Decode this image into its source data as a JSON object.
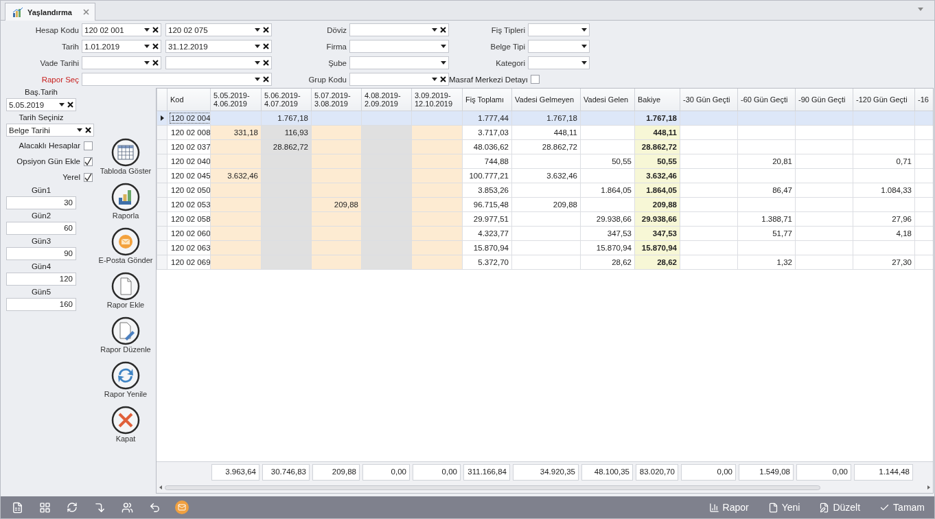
{
  "tab": {
    "title": "Yaşlandırma"
  },
  "filters": [
    {
      "label": "Hesap Kodu",
      "required": false,
      "fields": [
        {
          "value": "120 02 001",
          "clear": true
        },
        {
          "value": "120 02 075",
          "clear": true
        }
      ]
    },
    {
      "label": "Döviz",
      "required": false,
      "fields": [
        {
          "clear": true
        }
      ]
    },
    {
      "label": "Fiş Tipleri",
      "required": false,
      "fields": [
        {
          "clear": false
        }
      ]
    },
    {
      "label": "Tarih",
      "required": false,
      "fields": [
        {
          "value": "1.01.2019",
          "clear": true
        },
        {
          "value": "31.12.2019",
          "clear": true
        }
      ]
    },
    {
      "label": "Firma",
      "required": false,
      "fields": [
        {
          "clear": false
        }
      ]
    },
    {
      "label": "Belge Tipi",
      "required": false,
      "fields": [
        {
          "clear": false
        }
      ]
    },
    {
      "label": "Vade Tarihi",
      "required": false,
      "fields": [
        {
          "clear": true
        },
        {
          "clear": true
        }
      ]
    },
    {
      "label": "Şube",
      "required": false,
      "fields": [
        {
          "clear": false
        }
      ]
    },
    {
      "label": "Kategori",
      "required": false,
      "fields": [
        {
          "clear": false
        }
      ]
    },
    {
      "label": "Rapor Seç",
      "required": true,
      "fields": [
        {
          "clear": true
        }
      ]
    },
    {
      "label": "Grup Kodu",
      "required": false,
      "fields": [
        {
          "clear": true
        }
      ]
    }
  ],
  "cost_center": {
    "label": "Masraf Merkezi Detayı",
    "checked": false
  },
  "options": {
    "start_label": "Baş.Tarih",
    "start_value": "5.05.2019",
    "date_label": "Tarih Seçiniz",
    "date_value": "Belge Tarihi",
    "checks": [
      {
        "label": "Alacaklı Hesaplar",
        "checked": false
      },
      {
        "label": "Opsiyon Gün Ekle",
        "checked": true
      },
      {
        "label": "Yerel",
        "checked": true
      }
    ],
    "days": [
      {
        "label": "Gün1",
        "value": "30"
      },
      {
        "label": "Gün2",
        "value": "60"
      },
      {
        "label": "Gün3",
        "value": "90"
      },
      {
        "label": "Gün4",
        "value": "120"
      },
      {
        "label": "Gün5",
        "value": "160"
      }
    ]
  },
  "actions": [
    {
      "kind": "table",
      "label": "Tabloda Göster"
    },
    {
      "kind": "chart",
      "label": "Raporla"
    },
    {
      "kind": "mail",
      "label": "E-Posta Gönder"
    },
    {
      "kind": "new",
      "label": "Rapor Ekle"
    },
    {
      "kind": "edit",
      "label": "Rapor Düzenle"
    },
    {
      "kind": "refresh",
      "label": "Rapor Yenile"
    },
    {
      "kind": "close",
      "label": "Kapat"
    }
  ],
  "table": {
    "columns": [
      {
        "label": "Kod",
        "kind": "code"
      },
      {
        "label": "5.05.2019-\n4.06.2019",
        "kind": "date",
        "color": "#fdebd2"
      },
      {
        "label": "5.06.2019-\n4.07.2019",
        "kind": "date",
        "color": "#e0e0e0"
      },
      {
        "label": "5.07.2019-\n3.08.2019",
        "kind": "date",
        "color": "#fdebd2"
      },
      {
        "label": "4.08.2019-\n2.09.2019",
        "kind": "date",
        "color": "#e0e0e0"
      },
      {
        "label": "3.09.2019-\n12.10.2019",
        "kind": "date",
        "color": "#fdebd2"
      },
      {
        "label": "Fiş Toplamı",
        "kind": "amount"
      },
      {
        "label": "Vadesi Gelmeyen",
        "kind": "amount"
      },
      {
        "label": "Vadesi Gelen",
        "kind": "amount"
      },
      {
        "label": "Bakiye",
        "kind": "balance",
        "color": "#f7f7d6"
      },
      {
        "label": "-30 Gün Geçti",
        "kind": "amount"
      },
      {
        "label": "-60 Gün Geçti",
        "kind": "amount"
      },
      {
        "label": "-90 Gün Geçti",
        "kind": "amount"
      },
      {
        "label": "-120 Gün Geçti",
        "kind": "amount"
      },
      {
        "label": "-16",
        "kind": "amount"
      }
    ],
    "rows": [
      {
        "selected": true,
        "cells": [
          "120 02 004",
          null,
          "1.767,18",
          null,
          null,
          null,
          "1.777,44",
          "1.767,18",
          null,
          "1.767,18",
          null,
          null,
          null,
          null,
          null
        ]
      },
      {
        "selected": false,
        "cells": [
          "120 02 008",
          "331,18",
          "116,93",
          null,
          null,
          null,
          "3.717,03",
          "448,11",
          null,
          "448,11",
          null,
          null,
          null,
          null,
          null
        ]
      },
      {
        "selected": false,
        "cells": [
          "120 02 037",
          null,
          "28.862,72",
          null,
          null,
          null,
          "48.036,62",
          "28.862,72",
          null,
          "28.862,72",
          null,
          null,
          null,
          null,
          null
        ]
      },
      {
        "selected": false,
        "cells": [
          "120 02 040",
          null,
          null,
          null,
          null,
          null,
          "744,88",
          null,
          "50,55",
          "50,55",
          null,
          "20,81",
          null,
          "0,71",
          null
        ]
      },
      {
        "selected": false,
        "cells": [
          "120 02 045",
          "3.632,46",
          null,
          null,
          null,
          null,
          "100.777,21",
          "3.632,46",
          null,
          "3.632,46",
          null,
          null,
          null,
          null,
          null
        ]
      },
      {
        "selected": false,
        "cells": [
          "120 02 050",
          null,
          null,
          null,
          null,
          null,
          "3.853,26",
          null,
          "1.864,05",
          "1.864,05",
          null,
          "86,47",
          null,
          "1.084,33",
          null
        ]
      },
      {
        "selected": false,
        "cells": [
          "120 02 053",
          null,
          null,
          "209,88",
          null,
          null,
          "96.715,48",
          "209,88",
          null,
          "209,88",
          null,
          null,
          null,
          null,
          null
        ]
      },
      {
        "selected": false,
        "cells": [
          "120 02 058",
          null,
          null,
          null,
          null,
          null,
          "29.977,51",
          null,
          "29.938,66",
          "29.938,66",
          null,
          "1.388,71",
          null,
          "27,96",
          null
        ]
      },
      {
        "selected": false,
        "cells": [
          "120 02 060",
          null,
          null,
          null,
          null,
          null,
          "4.323,77",
          null,
          "347,53",
          "347,53",
          null,
          "51,77",
          null,
          "4,18",
          null
        ]
      },
      {
        "selected": false,
        "cells": [
          "120 02 063",
          null,
          null,
          null,
          null,
          null,
          "15.870,94",
          null,
          "15.870,94",
          "15.870,94",
          null,
          null,
          null,
          null,
          null
        ]
      },
      {
        "selected": false,
        "cells": [
          "120 02 069",
          null,
          null,
          null,
          null,
          null,
          "5.372,70",
          null,
          "28,62",
          "28,62",
          null,
          "1,32",
          null,
          "27,30",
          null
        ]
      }
    ],
    "totals": [
      "3.963,64",
      "30.746,83",
      "209,88",
      "0,00",
      "0,00",
      "311.166,84",
      "34.920,35",
      "48.100,35",
      "83.020,70",
      "0,00",
      "1.549,08",
      "0,00",
      "1.144,48"
    ]
  },
  "toolbar": {
    "buttons": [
      {
        "kind": "report",
        "label": "Rapor"
      },
      {
        "kind": "new",
        "label": "Yeni"
      },
      {
        "kind": "edit",
        "label": "Düzelt"
      },
      {
        "kind": "ok",
        "label": "Tamam"
      }
    ]
  }
}
